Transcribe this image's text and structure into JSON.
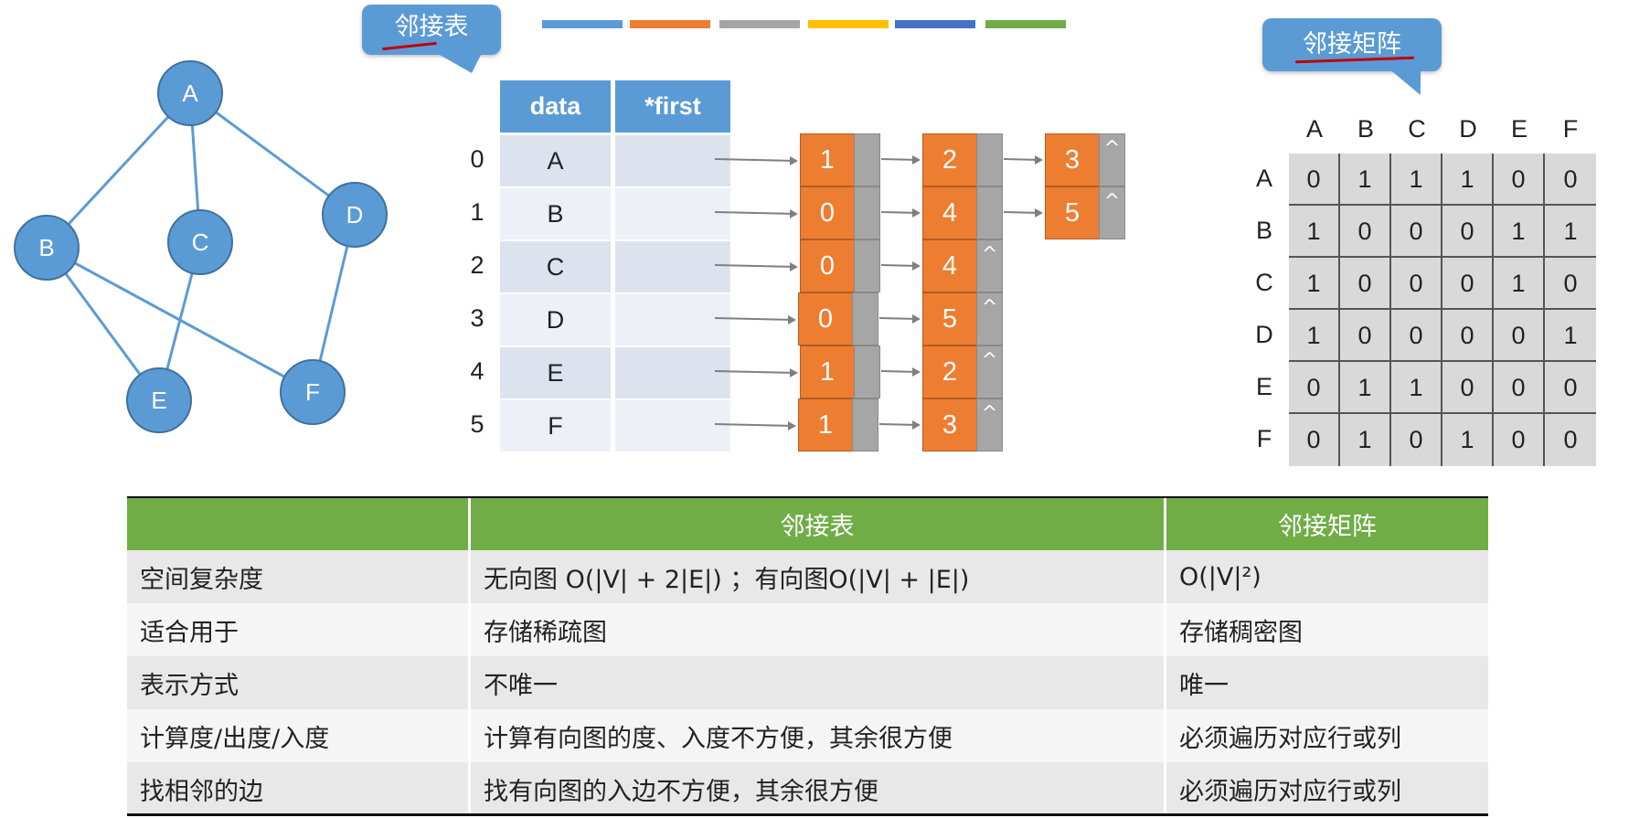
{
  "graph": {
    "nodes": [
      "A",
      "B",
      "C",
      "D",
      "E",
      "F"
    ],
    "edges": [
      [
        "A",
        "B"
      ],
      [
        "A",
        "C"
      ],
      [
        "A",
        "D"
      ],
      [
        "B",
        "E"
      ],
      [
        "B",
        "F"
      ],
      [
        "C",
        "E"
      ],
      [
        "D",
        "F"
      ]
    ]
  },
  "callouts": {
    "adj_list": "邻接表",
    "adj_matrix": "邻接矩阵"
  },
  "colors": {
    "node": "#5b9bd5",
    "node_border": "#41719c",
    "edge": "#5b9bd5",
    "list_node": "#ed7d31",
    "pointer": "#a6a6a6",
    "table_header": "#70ad47",
    "underline": "#c00000",
    "strip": [
      "#5b9bd5",
      "#ed7d31",
      "#a5a5a5",
      "#ffc000",
      "#4472c4",
      "#70ad47"
    ]
  },
  "adj_list": {
    "headers": [
      "data",
      "*first"
    ],
    "rows": [
      {
        "index": "0",
        "data": "A",
        "arcs": [
          "1",
          "2",
          "3"
        ]
      },
      {
        "index": "1",
        "data": "B",
        "arcs": [
          "0",
          "4",
          "5"
        ]
      },
      {
        "index": "2",
        "data": "C",
        "arcs": [
          "0",
          "4"
        ]
      },
      {
        "index": "3",
        "data": "D",
        "arcs": [
          "0",
          "5"
        ]
      },
      {
        "index": "4",
        "data": "E",
        "arcs": [
          "1",
          "2"
        ]
      },
      {
        "index": "5",
        "data": "F",
        "arcs": [
          "1",
          "3"
        ]
      }
    ],
    "null_symbol": "^"
  },
  "matrix": {
    "labels": [
      "A",
      "B",
      "C",
      "D",
      "E",
      "F"
    ],
    "rows": [
      [
        "0",
        "1",
        "1",
        "1",
        "0",
        "0"
      ],
      [
        "1",
        "0",
        "0",
        "0",
        "1",
        "1"
      ],
      [
        "1",
        "0",
        "0",
        "0",
        "1",
        "0"
      ],
      [
        "1",
        "0",
        "0",
        "0",
        "0",
        "1"
      ],
      [
        "0",
        "1",
        "1",
        "0",
        "0",
        "0"
      ],
      [
        "0",
        "1",
        "0",
        "1",
        "0",
        "0"
      ]
    ]
  },
  "comparison": {
    "headers": [
      "",
      "邻接表",
      "邻接矩阵"
    ],
    "rows": [
      [
        "空间复杂度",
        "无向图 O(|V| + 2|E|) ；有向图O(|V| + |E|)",
        "O(|V|²)"
      ],
      [
        "适合用于",
        "存储稀疏图",
        "存储稠密图"
      ],
      [
        "表示方式",
        "不唯一",
        "唯一"
      ],
      [
        "计算度/出度/入度",
        "计算有向图的度、入度不方便，其余很方便",
        "必须遍历对应行或列"
      ],
      [
        "找相邻的边",
        "找有向图的入边不方便，其余很方便",
        "必须遍历对应行或列"
      ]
    ]
  }
}
